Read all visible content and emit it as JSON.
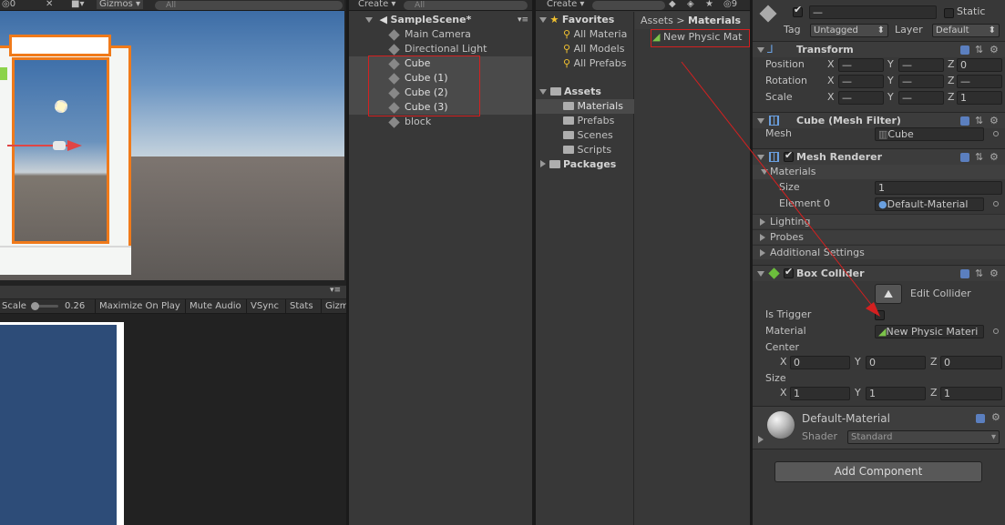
{
  "scene_toolbar": {
    "layers_count": "0",
    "gizmos_label": "Gizmos",
    "search_placeholder": "All"
  },
  "game_toolbar": {
    "scale_label": "Scale",
    "scale_value": "0.26",
    "maximize_label": "Maximize On Play",
    "mute_label": "Mute Audio",
    "vsync_label": "VSync",
    "stats_label": "Stats",
    "gizmos_label": "Gizm"
  },
  "hierarchy": {
    "create_label": "Create",
    "search_placeholder": "All",
    "scene_name": "SampleScene*",
    "items": [
      {
        "label": "Main Camera"
      },
      {
        "label": "Directional Light"
      },
      {
        "label": "Cube"
      },
      {
        "label": "Cube (1)"
      },
      {
        "label": "Cube (2)"
      },
      {
        "label": "Cube (3)"
      },
      {
        "label": "block"
      }
    ]
  },
  "project": {
    "create_label": "Create",
    "hidden_count": "9",
    "favorites_label": "Favorites",
    "favorites": [
      {
        "label": "All Materia"
      },
      {
        "label": "All Models"
      },
      {
        "label": "All Prefabs"
      }
    ],
    "assets_label": "Assets",
    "folders": [
      {
        "label": "Materials"
      },
      {
        "label": "Prefabs"
      },
      {
        "label": "Scenes"
      },
      {
        "label": "Scripts"
      }
    ],
    "packages_label": "Packages",
    "breadcrumb_root": "Assets",
    "breadcrumb_sep": ">",
    "breadcrumb_current": "Materials",
    "file_label": "New Physic Mat"
  },
  "inspector": {
    "static_label": "Static",
    "tag_label": "Tag",
    "tag_value": "Untagged",
    "layer_label": "Layer",
    "layer_value": "Default",
    "transform": {
      "title": "Transform",
      "position_label": "Position",
      "rotation_label": "Rotation",
      "scale_label": "Scale",
      "x": "X",
      "y": "Y",
      "z": "Z",
      "dash": "—",
      "pos_z": "0",
      "scale_z": "1"
    },
    "mesh_filter": {
      "title": "Cube (Mesh Filter)",
      "mesh_label": "Mesh",
      "mesh_value": "Cube"
    },
    "mesh_renderer": {
      "title": "Mesh Renderer",
      "materials_label": "Materials",
      "size_label": "Size",
      "size_value": "1",
      "element0_label": "Element 0",
      "element0_value": "Default-Material",
      "lighting_label": "Lighting",
      "probes_label": "Probes",
      "additional_label": "Additional Settings"
    },
    "box_collider": {
      "title": "Box Collider",
      "edit_label": "Edit Collider",
      "is_trigger_label": "Is Trigger",
      "material_label": "Material",
      "material_value": "New Physic Materi",
      "center_label": "Center",
      "center_x": "0",
      "center_y": "0",
      "center_z": "0",
      "size_label": "Size",
      "size_x": "1",
      "size_y": "1",
      "size_z": "1"
    },
    "material_preview": {
      "name": "Default-Material",
      "shader_label": "Shader",
      "shader_value": "Standard"
    },
    "add_component_label": "Add Component"
  }
}
